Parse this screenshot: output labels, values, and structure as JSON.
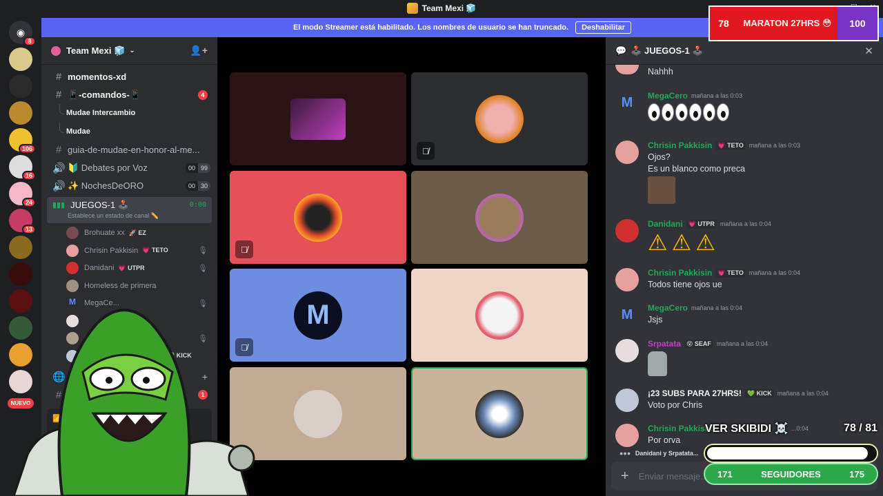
{
  "title_bar": {
    "title": "Team Mexi 🧊",
    "min": "—",
    "max": "☐",
    "close": "✕"
  },
  "rail": {
    "badges": [
      "8",
      "106",
      "16",
      "24",
      "13"
    ],
    "nuevo": "NUEVO"
  },
  "banner": {
    "text": "El modo Streamer está habilitado. Los nombres de usuario se han truncado.",
    "button": "Deshabilitar"
  },
  "sidebar": {
    "server_name": "Team Mexi 🧊",
    "channels": [
      {
        "name": "momentos-xd",
        "unread": true
      },
      {
        "name": "📱-comandos-📱",
        "unread": true,
        "count": "4"
      }
    ],
    "threads": [
      "Mudae Intercambio",
      "Mudae"
    ],
    "text_channels2": [
      {
        "name": "guia-de-mudae-en-honor-al-me..."
      }
    ],
    "voice": [
      {
        "name": "🔰 Debates por Voz",
        "a": "00",
        "b": "99"
      },
      {
        "name": "✨ NochesDeORO",
        "a": "00",
        "b": "30"
      }
    ],
    "active": {
      "name": "JUEGOS-1 🕹️",
      "status": "Establece un estado de canal ✏️",
      "timer": "0:00"
    },
    "members": [
      {
        "name": "Brohuate xx",
        "tag": "🚀 EZ",
        "muted": ""
      },
      {
        "name": "Chrisin Pakkisin",
        "tag": "💗 TETO",
        "muted": "🎙"
      },
      {
        "name": "Danidani",
        "tag": "💗 UTPR",
        "muted": "🎙"
      },
      {
        "name": "Homeless de primera",
        "tag": "",
        "muted": ""
      },
      {
        "name": "MegaCe...",
        "tag": "",
        "muted": "🎙"
      },
      {
        "name": "",
        "tag": "",
        "muted": ""
      },
      {
        "name": "",
        "tag": "",
        "muted": "🎙"
      },
      {
        "name": "",
        "tag": "💚 KICK",
        "muted": ""
      }
    ],
    "bottom_count": "1",
    "voice_status": "Voz"
  },
  "chat": {
    "channel": "🕹️ JUEGOS-1 🕹️",
    "close": "✕",
    "messages": [
      {
        "author": "",
        "tag": "",
        "time": "",
        "text": "Nahhh"
      },
      {
        "author": "MegaCero",
        "tag": "",
        "time": "mañana a las 0:03",
        "text": ""
      },
      {
        "author": "Chrisin Pakkisin",
        "tag": "💗 TETO",
        "time": "mañana a las 0:03",
        "text": "Ojos?",
        "text2": "Es un blanco como preca"
      },
      {
        "author": "Danidani",
        "tag": "💗 UTPR",
        "time": "mañana a las 0:04",
        "text": ""
      },
      {
        "author": "Chrisin Pakkisin",
        "tag": "💗 TETO",
        "time": "mañana a las 0:04",
        "text": "Todos tiene ojos ue"
      },
      {
        "author": "MegaCero",
        "tag": "",
        "time": "mañana a las 0:04",
        "text": "Jsjs"
      },
      {
        "author": "Srpatata",
        "tag": "😵 SEAF",
        "time": "mañana a las 0:04",
        "text": ""
      },
      {
        "author": "¡23 SUBS PARA 27HRS!",
        "tag": "💚 KICK",
        "time": "mañana a las 0:04",
        "text": "Voto por Chris"
      },
      {
        "author": "Chrisin Pakkisin",
        "tag": "",
        "time": "...0:04",
        "text": "Por orva"
      }
    ],
    "typing": "Danidani y Srpatata...",
    "input_placeholder": "Enviar mensaje..."
  },
  "overlay": {
    "maraton_left": "78",
    "maraton_title": "MARATON 27HRS 😳",
    "maraton_right": "100",
    "skibidi_label": "VER SKIBIDI ☠️",
    "skibidi_count": "78  / 81",
    "skibidi_progress": 0.96,
    "followers_left": "171",
    "followers_label": "SEGUIDORES",
    "followers_right": "175"
  },
  "colors": {
    "accent": "#5865f2",
    "green": "#23a55a",
    "red": "#f23f43"
  }
}
